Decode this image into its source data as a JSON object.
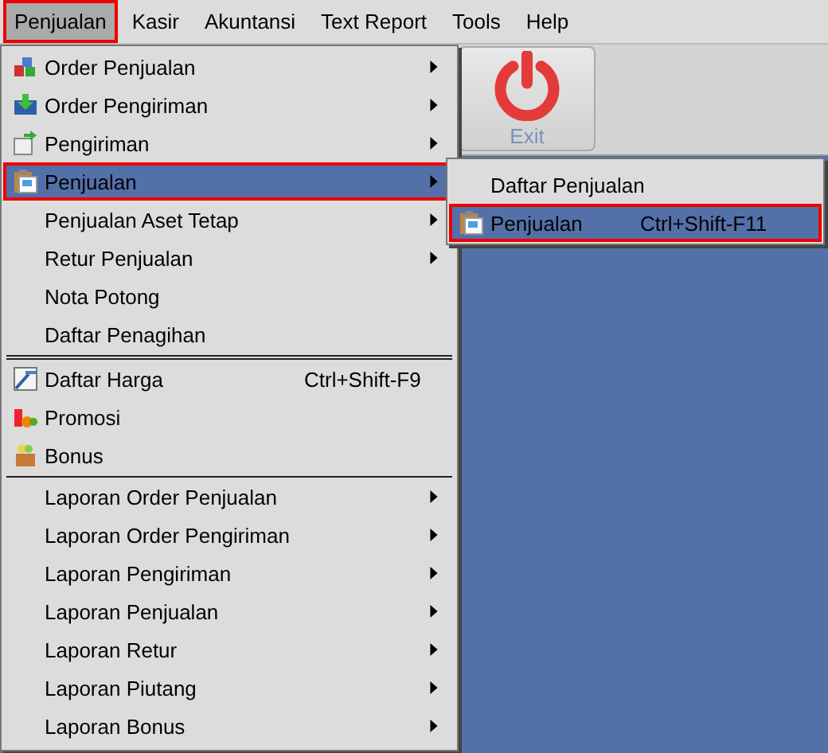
{
  "menubar": [
    {
      "label": "Penjualan",
      "selected": true,
      "highlighted": true
    },
    {
      "label": "Kasir",
      "selected": false,
      "highlighted": false
    },
    {
      "label": "Akuntansi",
      "selected": false,
      "highlighted": false
    },
    {
      "label": "Text Report",
      "selected": false,
      "highlighted": false
    },
    {
      "label": "Tools",
      "selected": false,
      "highlighted": false
    },
    {
      "label": "Help",
      "selected": false,
      "highlighted": false
    }
  ],
  "toolbar": {
    "exit_button": {
      "label": "Exit",
      "disabled": true
    }
  },
  "menu": {
    "items": [
      {
        "kind": "item",
        "label": "Order Penjualan",
        "icon": true,
        "submenu": true,
        "selected": false,
        "highlighted": false
      },
      {
        "kind": "item",
        "label": "Order Pengiriman",
        "icon": true,
        "submenu": true,
        "selected": false,
        "highlighted": false
      },
      {
        "kind": "item",
        "label": "Pengiriman",
        "icon": true,
        "submenu": true,
        "selected": false,
        "highlighted": false
      },
      {
        "kind": "item",
        "label": "Penjualan",
        "icon": true,
        "submenu": true,
        "selected": true,
        "highlighted": true
      },
      {
        "kind": "item",
        "label": "Penjualan Aset Tetap",
        "icon": false,
        "submenu": true,
        "selected": false,
        "highlighted": false
      },
      {
        "kind": "item",
        "label": "Retur Penjualan",
        "icon": false,
        "submenu": true,
        "selected": false,
        "highlighted": false
      },
      {
        "kind": "item",
        "label": "Nota Potong",
        "icon": false,
        "submenu": false,
        "selected": false,
        "highlighted": false
      },
      {
        "kind": "item",
        "label": "Daftar Penagihan",
        "icon": false,
        "submenu": false,
        "selected": false,
        "highlighted": false
      },
      {
        "kind": "double_separator"
      },
      {
        "kind": "item",
        "label": "Daftar Harga",
        "shortcut": "Ctrl+Shift-F9",
        "icon": true,
        "submenu": false,
        "selected": false,
        "highlighted": false
      },
      {
        "kind": "item",
        "label": "Promosi",
        "icon": true,
        "submenu": false,
        "selected": false,
        "highlighted": false
      },
      {
        "kind": "item",
        "label": "Bonus",
        "icon": true,
        "submenu": false,
        "selected": false,
        "highlighted": false
      },
      {
        "kind": "separator"
      },
      {
        "kind": "item",
        "label": "Laporan Order Penjualan",
        "icon": false,
        "submenu": true,
        "selected": false,
        "highlighted": false
      },
      {
        "kind": "item",
        "label": "Laporan Order Pengiriman",
        "icon": false,
        "submenu": true,
        "selected": false,
        "highlighted": false
      },
      {
        "kind": "item",
        "label": "Laporan Pengiriman",
        "icon": false,
        "submenu": true,
        "selected": false,
        "highlighted": false
      },
      {
        "kind": "item",
        "label": "Laporan Penjualan",
        "icon": false,
        "submenu": true,
        "selected": false,
        "highlighted": false
      },
      {
        "kind": "item",
        "label": "Laporan Retur",
        "icon": false,
        "submenu": true,
        "selected": false,
        "highlighted": false
      },
      {
        "kind": "item",
        "label": "Laporan Piutang",
        "icon": false,
        "submenu": true,
        "selected": false,
        "highlighted": false
      },
      {
        "kind": "item",
        "label": "Laporan Bonus",
        "icon": false,
        "submenu": true,
        "selected": false,
        "highlighted": false
      }
    ]
  },
  "submenu": {
    "items": [
      {
        "kind": "item",
        "label": "Daftar Penjualan",
        "icon": false,
        "submenu": false,
        "selected": false,
        "highlighted": false
      },
      {
        "kind": "item",
        "label": "Penjualan",
        "shortcut": "Ctrl+Shift-F11",
        "icon": true,
        "submenu": false,
        "selected": true,
        "highlighted": true
      }
    ]
  }
}
